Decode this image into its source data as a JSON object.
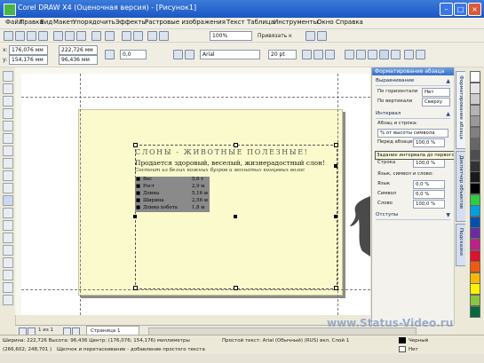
{
  "title_bar": {
    "title": "Corel DRAW X4 (Оценочная версия) - [Рисунок1]"
  },
  "menu": [
    "Файл",
    "Правка",
    "Вид",
    "Макет",
    "Упорядочить",
    "Эффекты",
    "Растровые изображения",
    "Текст",
    "Таблица",
    "Инструменты",
    "Окно",
    "Справка"
  ],
  "standard_bar": {
    "zoom": "100%",
    "snap_label": "Привязать к"
  },
  "property_bar": {
    "x": "176,076 мм",
    "y": "154,176 мм",
    "width": "222,726 мм",
    "height": "96,436 мм",
    "rotation": "0,0",
    "font": "Arial",
    "font_size": "20 pt"
  },
  "canvas": {
    "title_text": "СЛОНЫ - ЖИВОТНЫЕ ПОЛЕЗНЫЕ!",
    "subtitle_text": "Продается здоровый, веселый, жизнерадостный слон!",
    "description_text": "Состоит из белых кожных бугров и мохнатых концевых волос",
    "list": [
      {
        "bullet": "■",
        "name": "Вес",
        "value": "5,6 т"
      },
      {
        "bullet": "■",
        "name": "Рост",
        "value": "2,9 м"
      },
      {
        "bullet": "■",
        "name": "Длина",
        "value": "5,16 м"
      },
      {
        "bullet": "■",
        "name": "Ширина",
        "value": "2,56 м"
      },
      {
        "bullet": "■",
        "name": "Длина хобота",
        "value": "1,8 м"
      }
    ]
  },
  "docker": {
    "title": "Форматирование абзаца",
    "alignment": {
      "header": "Выравнивание",
      "horizontal_label": "По горизонтали",
      "horizontal_value": "Нет",
      "vertical_label": "По вертикали",
      "vertical_value": "Сверху"
    },
    "spacing": {
      "header": "Интервал",
      "line_label": "Абзац и строка:",
      "percent_label": "% от высоты символа",
      "before_label": "Перед абзацем",
      "before_value": "100,0 %",
      "line_spacing_label": "Строка",
      "line_spacing_value": "100,0 %",
      "lang_header": "Язык, символ и слово:",
      "lang_label": "Язык",
      "lang_value": "0,0 %",
      "char_label": "Символ",
      "char_value": "0,0 %",
      "word_label": "Слово",
      "word_value": "100,0 %"
    },
    "indent": {
      "header": "Отступы"
    },
    "tooltip": "Задание интервала до первого абзаца"
  },
  "docker_tabs": [
    "Форматирование абзаца",
    "Диспетчер объектов",
    "Подсказки"
  ],
  "pager": {
    "page_counter": "1 из 1",
    "page_tab": "Страница 1"
  },
  "status_bar": {
    "line1": "Ширина: 222,726  Высота: 96,436  Центр: (176,076; 154,176)  миллиметры",
    "line1_right": "Простой текст: Arial (Обычный) (RUS) вкл. Слой 1",
    "fill_label": "Черный",
    "line2": "(266,602; 248,701 )",
    "line2_hint": "Щелчок и перетаскивание - добавление простого текста",
    "outline_label": "Нет"
  },
  "watermark": "www.Status-Video.ru",
  "colors": {
    "page_fill": "#FAFACC",
    "list_fill": "#8A8A8A",
    "title_bar": "#1C56C6",
    "palette": [
      "#FFFFFF",
      "#E6E6E6",
      "#CCCCCC",
      "#B3B3B3",
      "#999999",
      "#808080",
      "#666666",
      "#4D4D4D",
      "#333333",
      "#1A1A1A",
      "#000000",
      "#2ECC40",
      "#00A0E0",
      "#0050B0",
      "#6A2CA0",
      "#C0208A",
      "#E0102E",
      "#F05A10",
      "#F8B800",
      "#FFF200",
      "#8BC53F",
      "#006B3F"
    ]
  }
}
